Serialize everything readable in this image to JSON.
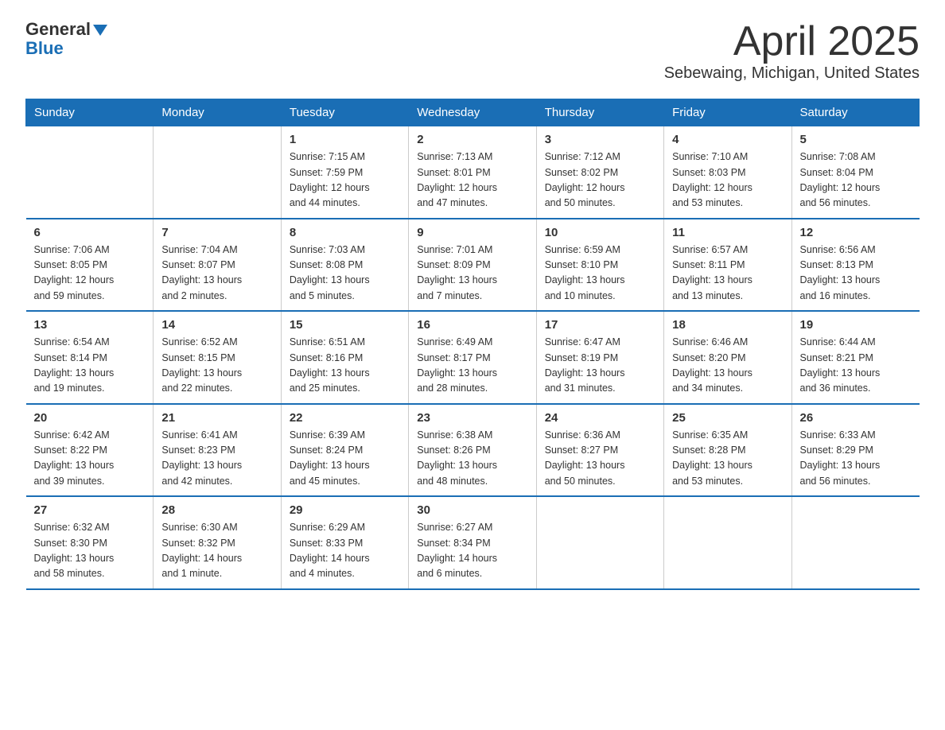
{
  "header": {
    "logo_general": "General",
    "logo_blue": "Blue",
    "title": "April 2025",
    "subtitle": "Sebewaing, Michigan, United States"
  },
  "weekdays": [
    "Sunday",
    "Monday",
    "Tuesday",
    "Wednesday",
    "Thursday",
    "Friday",
    "Saturday"
  ],
  "weeks": [
    [
      {
        "day": "",
        "info": ""
      },
      {
        "day": "",
        "info": ""
      },
      {
        "day": "1",
        "info": "Sunrise: 7:15 AM\nSunset: 7:59 PM\nDaylight: 12 hours\nand 44 minutes."
      },
      {
        "day": "2",
        "info": "Sunrise: 7:13 AM\nSunset: 8:01 PM\nDaylight: 12 hours\nand 47 minutes."
      },
      {
        "day": "3",
        "info": "Sunrise: 7:12 AM\nSunset: 8:02 PM\nDaylight: 12 hours\nand 50 minutes."
      },
      {
        "day": "4",
        "info": "Sunrise: 7:10 AM\nSunset: 8:03 PM\nDaylight: 12 hours\nand 53 minutes."
      },
      {
        "day": "5",
        "info": "Sunrise: 7:08 AM\nSunset: 8:04 PM\nDaylight: 12 hours\nand 56 minutes."
      }
    ],
    [
      {
        "day": "6",
        "info": "Sunrise: 7:06 AM\nSunset: 8:05 PM\nDaylight: 12 hours\nand 59 minutes."
      },
      {
        "day": "7",
        "info": "Sunrise: 7:04 AM\nSunset: 8:07 PM\nDaylight: 13 hours\nand 2 minutes."
      },
      {
        "day": "8",
        "info": "Sunrise: 7:03 AM\nSunset: 8:08 PM\nDaylight: 13 hours\nand 5 minutes."
      },
      {
        "day": "9",
        "info": "Sunrise: 7:01 AM\nSunset: 8:09 PM\nDaylight: 13 hours\nand 7 minutes."
      },
      {
        "day": "10",
        "info": "Sunrise: 6:59 AM\nSunset: 8:10 PM\nDaylight: 13 hours\nand 10 minutes."
      },
      {
        "day": "11",
        "info": "Sunrise: 6:57 AM\nSunset: 8:11 PM\nDaylight: 13 hours\nand 13 minutes."
      },
      {
        "day": "12",
        "info": "Sunrise: 6:56 AM\nSunset: 8:13 PM\nDaylight: 13 hours\nand 16 minutes."
      }
    ],
    [
      {
        "day": "13",
        "info": "Sunrise: 6:54 AM\nSunset: 8:14 PM\nDaylight: 13 hours\nand 19 minutes."
      },
      {
        "day": "14",
        "info": "Sunrise: 6:52 AM\nSunset: 8:15 PM\nDaylight: 13 hours\nand 22 minutes."
      },
      {
        "day": "15",
        "info": "Sunrise: 6:51 AM\nSunset: 8:16 PM\nDaylight: 13 hours\nand 25 minutes."
      },
      {
        "day": "16",
        "info": "Sunrise: 6:49 AM\nSunset: 8:17 PM\nDaylight: 13 hours\nand 28 minutes."
      },
      {
        "day": "17",
        "info": "Sunrise: 6:47 AM\nSunset: 8:19 PM\nDaylight: 13 hours\nand 31 minutes."
      },
      {
        "day": "18",
        "info": "Sunrise: 6:46 AM\nSunset: 8:20 PM\nDaylight: 13 hours\nand 34 minutes."
      },
      {
        "day": "19",
        "info": "Sunrise: 6:44 AM\nSunset: 8:21 PM\nDaylight: 13 hours\nand 36 minutes."
      }
    ],
    [
      {
        "day": "20",
        "info": "Sunrise: 6:42 AM\nSunset: 8:22 PM\nDaylight: 13 hours\nand 39 minutes."
      },
      {
        "day": "21",
        "info": "Sunrise: 6:41 AM\nSunset: 8:23 PM\nDaylight: 13 hours\nand 42 minutes."
      },
      {
        "day": "22",
        "info": "Sunrise: 6:39 AM\nSunset: 8:24 PM\nDaylight: 13 hours\nand 45 minutes."
      },
      {
        "day": "23",
        "info": "Sunrise: 6:38 AM\nSunset: 8:26 PM\nDaylight: 13 hours\nand 48 minutes."
      },
      {
        "day": "24",
        "info": "Sunrise: 6:36 AM\nSunset: 8:27 PM\nDaylight: 13 hours\nand 50 minutes."
      },
      {
        "day": "25",
        "info": "Sunrise: 6:35 AM\nSunset: 8:28 PM\nDaylight: 13 hours\nand 53 minutes."
      },
      {
        "day": "26",
        "info": "Sunrise: 6:33 AM\nSunset: 8:29 PM\nDaylight: 13 hours\nand 56 minutes."
      }
    ],
    [
      {
        "day": "27",
        "info": "Sunrise: 6:32 AM\nSunset: 8:30 PM\nDaylight: 13 hours\nand 58 minutes."
      },
      {
        "day": "28",
        "info": "Sunrise: 6:30 AM\nSunset: 8:32 PM\nDaylight: 14 hours\nand 1 minute."
      },
      {
        "day": "29",
        "info": "Sunrise: 6:29 AM\nSunset: 8:33 PM\nDaylight: 14 hours\nand 4 minutes."
      },
      {
        "day": "30",
        "info": "Sunrise: 6:27 AM\nSunset: 8:34 PM\nDaylight: 14 hours\nand 6 minutes."
      },
      {
        "day": "",
        "info": ""
      },
      {
        "day": "",
        "info": ""
      },
      {
        "day": "",
        "info": ""
      }
    ]
  ]
}
